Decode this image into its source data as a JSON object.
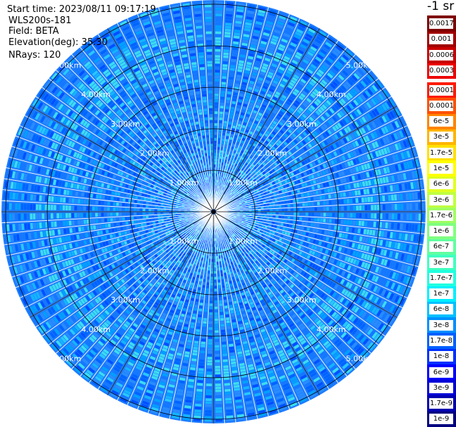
{
  "header": {
    "start_time": "Start time: 2023/08/11 09:17:19",
    "instrument": "WLS200s-181",
    "field": "Field: BETA",
    "elevation": "Elevation(deg): 35.30",
    "nrays": "NRays: 120"
  },
  "colorbar": {
    "title": "-1 sr",
    "upper_labels": [
      "0.0017",
      "0.001",
      "0.0006",
      "0.0003"
    ],
    "upper_colors": [
      "#7f0000",
      "#a00000",
      "#c80000",
      "#ee0000"
    ],
    "lower_labels": [
      "0.00017",
      "0.0001",
      "6e-5",
      "3e-5",
      "1.7e-5",
      "1e-5",
      "6e-6",
      "3e-6",
      "1.7e-6",
      "1e-6",
      "6e-7",
      "3e-7",
      "1.7e-7",
      "1e-7",
      "6e-8",
      "3e-8",
      "1.7e-8",
      "1e-8",
      "6e-9",
      "3e-9",
      "1.7e-9",
      "1e-9"
    ],
    "lower_colors": [
      "#ff1a00",
      "#ff5000",
      "#ff8400",
      "#ffb400",
      "#ffe000",
      "#ffff00",
      "#e0ff20",
      "#c0ff40",
      "#a0ff60",
      "#80ff80",
      "#60ffa0",
      "#40ffc0",
      "#20ffe0",
      "#00f0ff",
      "#00c0ff",
      "#0090ff",
      "#0060ff",
      "#0030ff",
      "#0000ff",
      "#0000d8",
      "#0000b0",
      "#000080"
    ]
  },
  "chart_data": {
    "type": "heatmap",
    "projection": "polar-ppi",
    "field": "BETA",
    "elevation_deg": 35.3,
    "nrays": 120,
    "range_rings_km": [
      1,
      2,
      3,
      4,
      5
    ],
    "ring_labels": [
      "1.00km",
      "2.00km",
      "3.00km",
      "4.00km",
      "5.00km"
    ],
    "max_range_km": 5.1,
    "radial_gates_per_km": 14,
    "radial_spoke_step_deg": 30,
    "grid": true,
    "background_level": "approx 1e-8 to 1e-7 sr-1 (blue / light blue)",
    "palette": [
      "#0050ff",
      "#0064ff",
      "#1478ff",
      "#288cff",
      "#00a0ff",
      "#14b4ff",
      "#28c8ff",
      "#3cdcf0"
    ],
    "palette_weights": [
      10,
      16,
      20,
      18,
      14,
      10,
      7,
      5
    ]
  }
}
